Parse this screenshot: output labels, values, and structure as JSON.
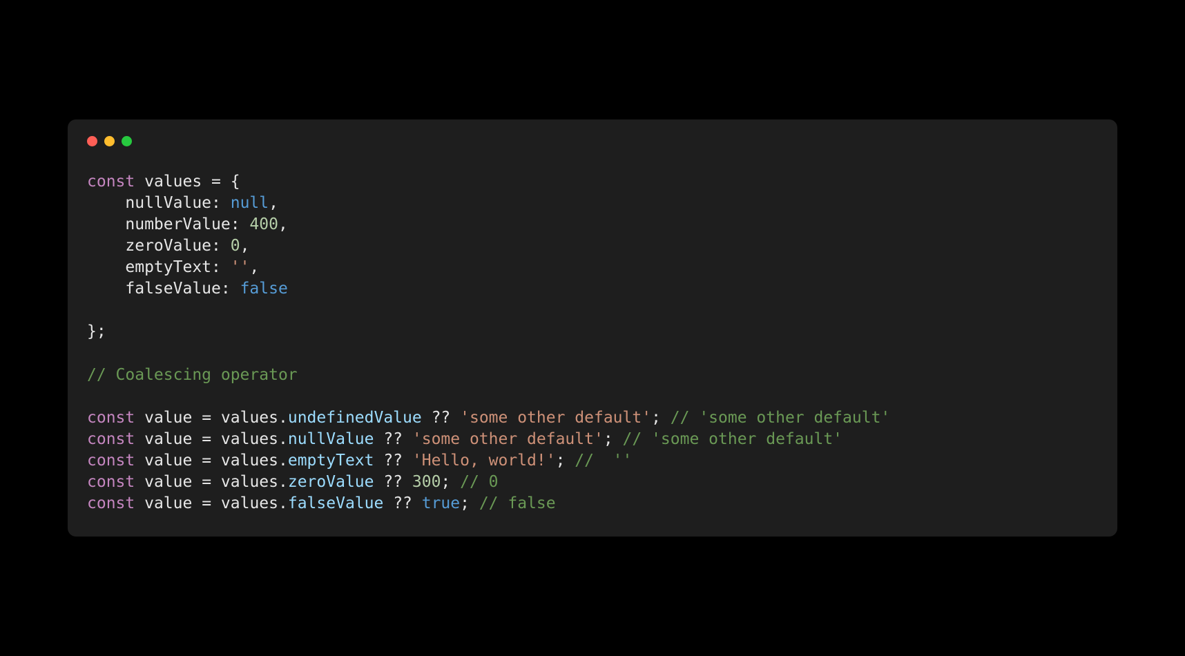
{
  "code": {
    "l1_const": "const",
    "l1_values": "values",
    "l1_eq": " = {",
    "l2_prop": "nullValue",
    "l2_colon": ": ",
    "l2_val": "null",
    "l2_comma": ",",
    "l3_prop": "numberValue",
    "l3_colon": ": ",
    "l3_val": "400",
    "l3_comma": ",",
    "l4_prop": "zeroValue",
    "l4_colon": ": ",
    "l4_val": "0",
    "l4_comma": ",",
    "l5_prop": "emptyText",
    "l5_colon": ": ",
    "l5_val": "''",
    "l5_comma": ",",
    "l6_prop": "falseValue",
    "l6_colon": ": ",
    "l6_val": "false",
    "l7_close": "};",
    "l8_comment": "// Coalescing operator",
    "l9_const": "const",
    "l9_value": "value",
    "l9_eq": " = ",
    "l9_obj": "values",
    "l9_dot": ".",
    "l9_prop": "undefinedValue",
    "l9_op": " ?? ",
    "l9_str": "'some other default'",
    "l9_semi": "; ",
    "l9_cmt": "// 'some other default'",
    "l10_const": "const",
    "l10_value": "value",
    "l10_eq": " = ",
    "l10_obj": "values",
    "l10_dot": ".",
    "l10_prop": "nullValue",
    "l10_op": " ?? ",
    "l10_str": "'some other default'",
    "l10_semi": "; ",
    "l10_cmt": "// 'some other default'",
    "l11_const": "const",
    "l11_value": "value",
    "l11_eq": " = ",
    "l11_obj": "values",
    "l11_dot": ".",
    "l11_prop": "emptyText",
    "l11_op": " ?? ",
    "l11_str": "'Hello, world!'",
    "l11_semi": "; ",
    "l11_cmt": "//  ''",
    "l12_const": "const",
    "l12_value": "value",
    "l12_eq": " = ",
    "l12_obj": "values",
    "l12_dot": ".",
    "l12_prop": "zeroValue",
    "l12_op": " ?? ",
    "l12_num": "300",
    "l12_semi": "; ",
    "l12_cmt": "// 0",
    "l13_const": "const",
    "l13_value": "value",
    "l13_eq": " = ",
    "l13_obj": "values",
    "l13_dot": ".",
    "l13_prop": "falseValue",
    "l13_op": " ?? ",
    "l13_bool": "true",
    "l13_semi": "; ",
    "l13_cmt": "// false"
  }
}
